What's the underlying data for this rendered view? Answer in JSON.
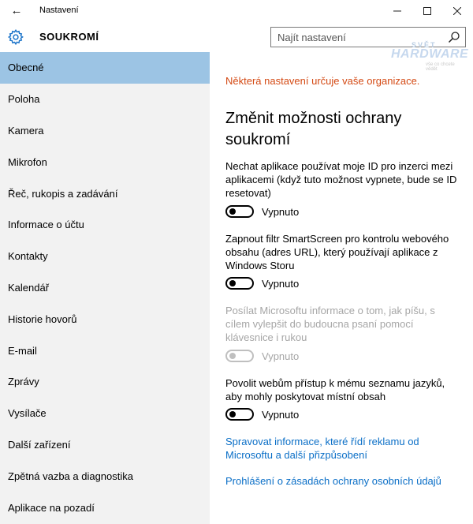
{
  "titlebar": {
    "back_icon": "back-arrow-icon",
    "app_title": "Nastavení",
    "minimize_icon": "minimize-icon",
    "maximize_icon": "maximize-icon",
    "close_icon": "close-icon"
  },
  "header": {
    "icon": "gear-icon",
    "title": "SOUKROMÍ",
    "accent_color": "#1a73c9",
    "search": {
      "placeholder": "Najít nastavení",
      "icon": "search-icon"
    }
  },
  "watermark": {
    "top": "SVĚT",
    "main": "HARDWARE",
    "sub": "vše co chcete vědět"
  },
  "sidebar": {
    "active_color": "#9cc4e4",
    "items": [
      {
        "label": "Obecné",
        "active": true
      },
      {
        "label": "Poloha"
      },
      {
        "label": "Kamera"
      },
      {
        "label": "Mikrofon"
      },
      {
        "label": "Řeč, rukopis a zadávání"
      },
      {
        "label": "Informace o účtu"
      },
      {
        "label": "Kontakty"
      },
      {
        "label": "Kalendář"
      },
      {
        "label": "Historie hovorů"
      },
      {
        "label": "E-mail"
      },
      {
        "label": "Zprávy"
      },
      {
        "label": "Vysílače"
      },
      {
        "label": "Další zařízení"
      },
      {
        "label": "Zpětná vazba a diagnostika"
      },
      {
        "label": "Aplikace na pozadí"
      }
    ]
  },
  "content": {
    "org_note": "Některá nastavení určuje vaše organizace.",
    "org_note_color": "#d44a14",
    "section_title": "Změnit možnosti ochrany soukromí",
    "settings": [
      {
        "description": "Nechat aplikace používat moje ID pro inzerci mezi aplikacemi (když tuto možnost vypnete, bude se ID resetovat)",
        "state": "Vypnuto",
        "on": false,
        "disabled": false
      },
      {
        "description": "Zapnout filtr SmartScreen pro kontrolu webového obsahu (adres URL), který používají aplikace z Windows Storu",
        "state": "Vypnuto",
        "on": false,
        "disabled": false
      },
      {
        "description": "Posílat Microsoftu informace o tom, jak píšu, s cílem vylepšit do budoucna psaní pomocí klávesnice i rukou",
        "state": "Vypnuto",
        "on": false,
        "disabled": true
      },
      {
        "description": "Povolit webům přístup k mému seznamu jazyků, aby mohly poskytovat místní obsah",
        "state": "Vypnuto",
        "on": false,
        "disabled": false
      }
    ],
    "links": [
      {
        "label": "Spravovat informace, které řídí reklamu od Microsoftu a další přizpůsobení"
      },
      {
        "label": "Prohlášení o zásadách ochrany osobních údajů"
      }
    ],
    "link_color": "#0b6fc7"
  }
}
